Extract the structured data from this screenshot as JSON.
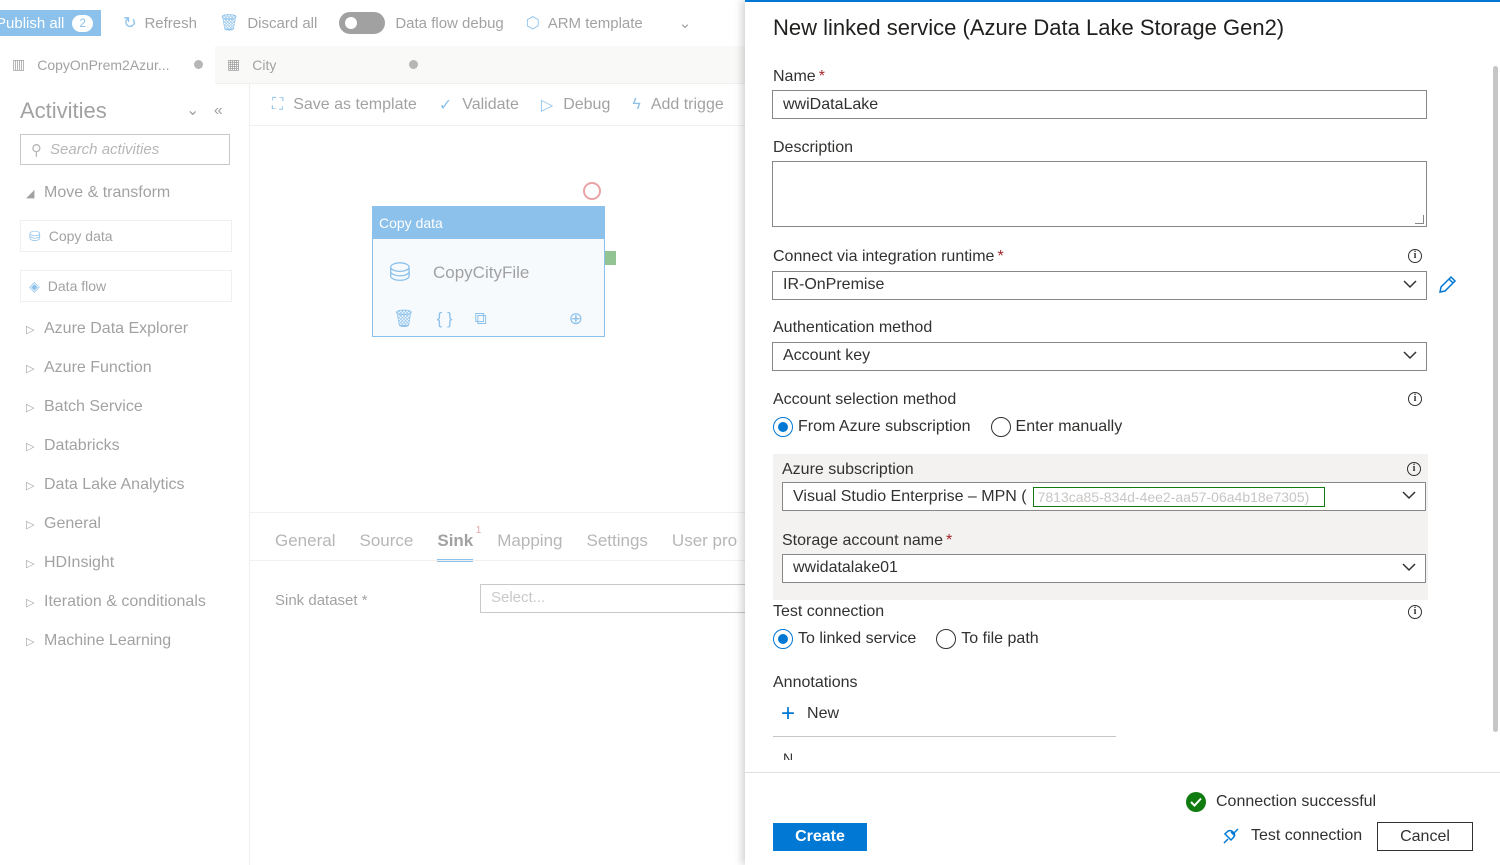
{
  "topbar": {
    "publish_label": "Publish all",
    "publish_count": "2",
    "refresh_label": "Refresh",
    "discard_label": "Discard all",
    "dataflow_debug_label": "Data flow debug",
    "arm_label": "ARM template"
  },
  "tabs": [
    {
      "label": "CopyOnPrem2Azur..."
    },
    {
      "label": "City"
    }
  ],
  "activities": {
    "title": "Activities",
    "search_placeholder": "Search activities",
    "group_move": "Move & transform",
    "item_copy": "Copy data",
    "item_dataflow": "Data flow",
    "groups": [
      "Azure Data Explorer",
      "Azure Function",
      "Batch Service",
      "Databricks",
      "Data Lake Analytics",
      "General",
      "HDInsight",
      "Iteration & conditionals",
      "Machine Learning"
    ]
  },
  "canvas_toolbar": {
    "save_template": "Save as template",
    "validate": "Validate",
    "debug": "Debug",
    "add_trigger": "Add trigge"
  },
  "activity_box": {
    "header": "Copy data",
    "name": "CopyCityFile"
  },
  "bottom_panel": {
    "tabs": [
      "General",
      "Source",
      "Sink",
      "Mapping",
      "Settings",
      "User pro"
    ],
    "sink_badge": "1",
    "sink_dataset_label": "Sink dataset *",
    "sink_select_placeholder": "Select..."
  },
  "panel": {
    "title": "New linked service (Azure Data Lake Storage Gen2)",
    "name_label": "Name",
    "name_value": "wwiDataLake",
    "description_label": "Description",
    "ir_label": "Connect via integration runtime",
    "ir_value": "IR-OnPremise",
    "auth_label": "Authentication method",
    "auth_value": "Account key",
    "account_sel_label": "Account selection method",
    "account_opt_azure": "From Azure subscription",
    "account_opt_manual": "Enter manually",
    "subscription_label": "Azure subscription",
    "subscription_value": "Visual Studio Enterprise – MPN (",
    "subscription_masked": "7813ca85-834d-4ee2-aa57-06a4b18e7305)",
    "storage_label": "Storage account name",
    "storage_value": "wwidatalake01",
    "test_label": "Test connection",
    "test_opt_linked": "To linked service",
    "test_opt_path": "To file path",
    "annotations_label": "Annotations",
    "annotations_new": "New",
    "annotations_cut": "N",
    "status_text": "Connection successful",
    "create_label": "Create",
    "test_connection_label": "Test connection",
    "cancel_label": "Cancel",
    "required_mark": "*"
  },
  "colors": {
    "accent": "#0078d4",
    "success": "#107c10",
    "required": "#a4262c"
  }
}
